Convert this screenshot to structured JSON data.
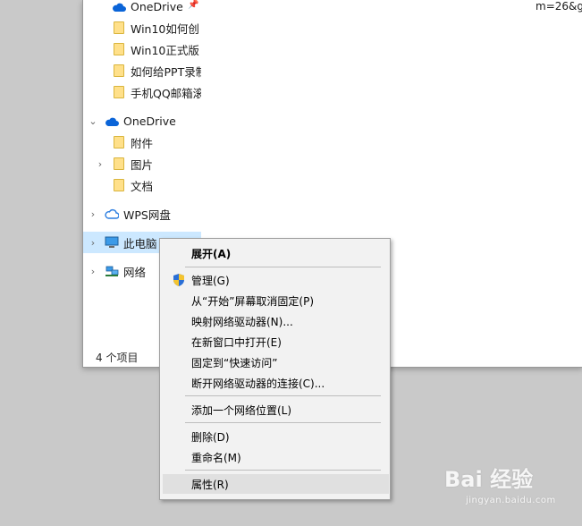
{
  "nav": {
    "items": [
      {
        "label": "OneDrive",
        "icon": "onedrive-cloud-icon",
        "pinned": true
      },
      {
        "label": "Win10如何创",
        "icon": "folder-icon"
      },
      {
        "label": "Win10正式版",
        "icon": "folder-icon"
      },
      {
        "label": "如何给PPT录制",
        "icon": "folder-icon"
      },
      {
        "label": "手机QQ邮箱滚",
        "icon": "folder-icon"
      },
      {
        "label": "OneDrive",
        "icon": "onedrive-cloud-icon",
        "expanded": true
      },
      {
        "label": "附件",
        "icon": "folder-icon"
      },
      {
        "label": "图片",
        "icon": "folder-icon"
      },
      {
        "label": "文档",
        "icon": "folder-icon"
      },
      {
        "label": "WPS网盘",
        "icon": "wps-cloud-icon"
      },
      {
        "label": "此电脑",
        "icon": "computer-icon",
        "selected": true
      },
      {
        "label": "网络",
        "icon": "network-icon"
      }
    ],
    "pin_glyph": "📌"
  },
  "status": {
    "item_count": "4 个项目"
  },
  "content": {
    "url_fragment": "m=26&g"
  },
  "context_menu": {
    "items": [
      {
        "label": "展开(A)",
        "bold": true
      },
      {
        "label": "管理(G)",
        "shield": true
      },
      {
        "label": "从“开始”屏幕取消固定(P)"
      },
      {
        "label": "映射网络驱动器(N)..."
      },
      {
        "label": "在新窗口中打开(E)"
      },
      {
        "label": "固定到“快速访问”"
      },
      {
        "label": "断开网络驱动器的连接(C)..."
      },
      {
        "label": "添加一个网络位置(L)"
      },
      {
        "label": "删除(D)"
      },
      {
        "label": "重命名(M)"
      },
      {
        "label": "属性(R)",
        "hover": true
      }
    ]
  },
  "watermark": {
    "brand": "Bai 经验",
    "site": "jingyan.baidu.com"
  },
  "colors": {
    "selection": "#cce8ff",
    "menu_bg": "#f2f2f2",
    "onedrive_blue": "#0a64d8",
    "folder_yellow": "#ffe08a"
  }
}
